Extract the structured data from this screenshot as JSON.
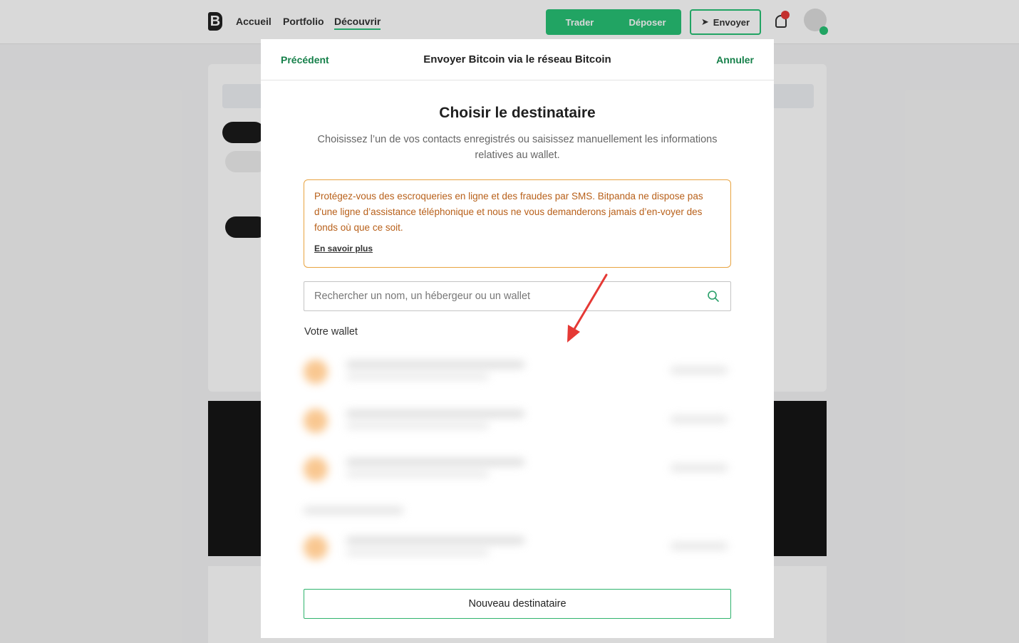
{
  "background": {
    "logo": "B",
    "nav": [
      "Accueil",
      "Portfolio",
      "Découvrir"
    ],
    "trade_label": "Trader",
    "deposit_label": "Déposer",
    "send_label": "Envoyer"
  },
  "modal": {
    "header": {
      "back": "Précédent",
      "title": "Envoyer Bitcoin via le réseau Bitcoin",
      "cancel": "Annuler"
    },
    "title": "Choisir le destinataire",
    "subtitle": "Choisissez l’un de vos contacts enregistrés ou saisissez manuellement les informations relatives au wallet.",
    "warning": {
      "text": "Protégez-vous des escroqueries en ligne et des fraudes par SMS. Bitpanda ne dispose pas d'une ligne d’assistance téléphonique et nous ne vous demanderons jamais d’en-voyer des fonds où que ce soit.",
      "link": "En savoir plus"
    },
    "search": {
      "placeholder": "Rechercher un nom, un hébergeur ou un wallet",
      "value": ""
    },
    "section_label": "Votre wallet",
    "new_recipient_label": "Nouveau destinataire"
  },
  "colors": {
    "accent_green": "#16804a",
    "warning_orange": "#e8a340",
    "annotation_red": "#e53935"
  }
}
